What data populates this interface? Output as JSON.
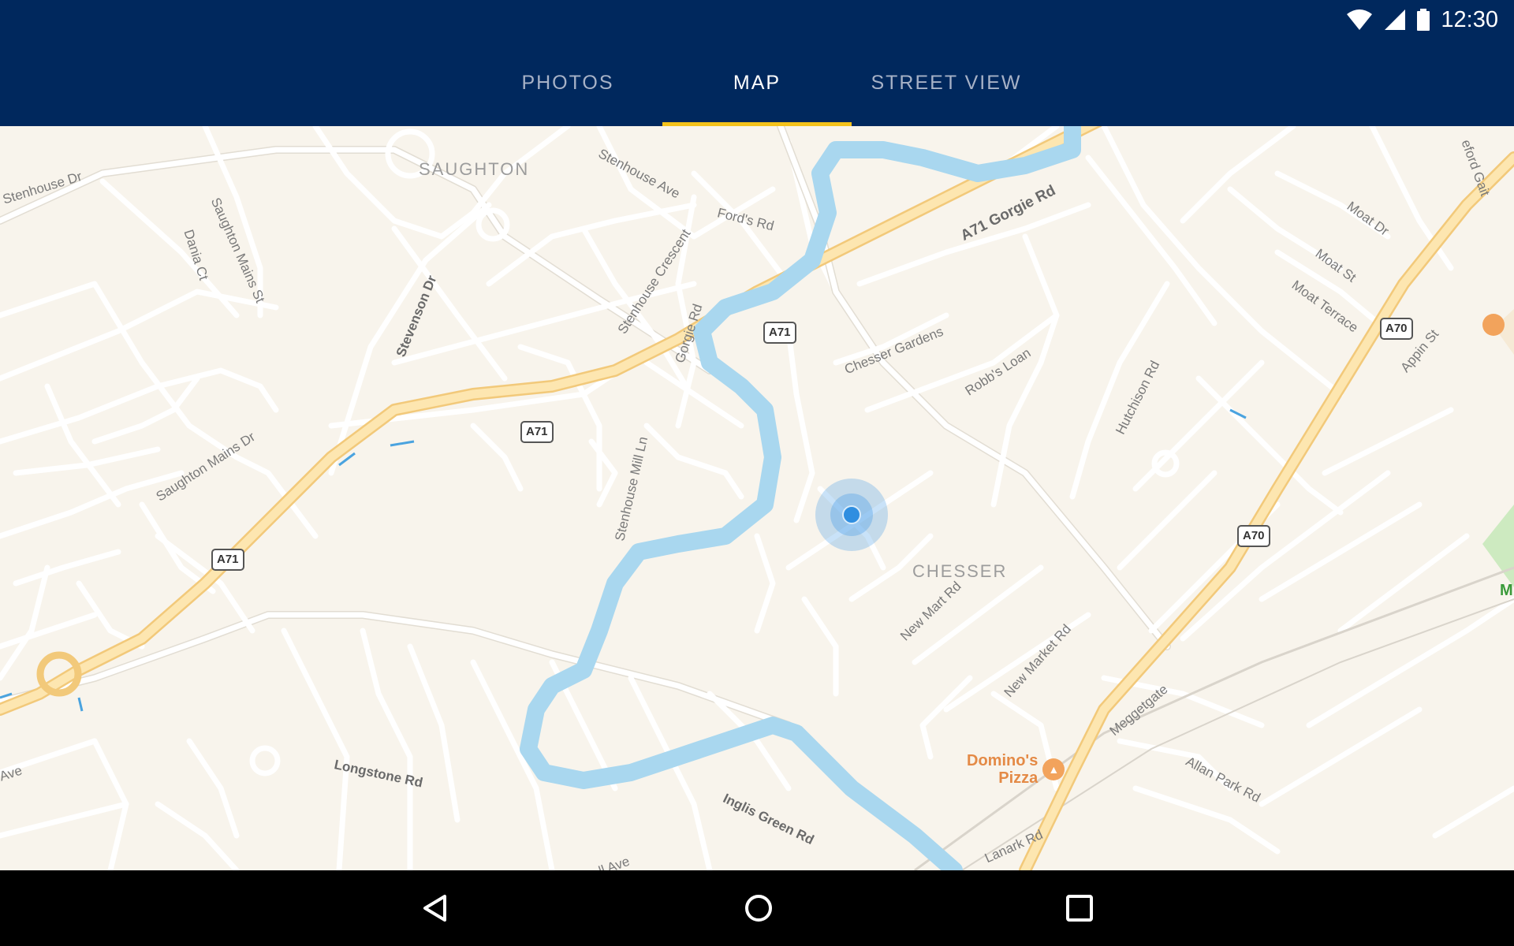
{
  "status": {
    "time": "12:30",
    "icons": [
      "wifi-icon",
      "cell-signal-icon",
      "battery-icon"
    ]
  },
  "tabs": [
    {
      "label": "PHOTOS",
      "active": false
    },
    {
      "label": "MAP",
      "active": true
    },
    {
      "label": "STREET VIEW",
      "active": false
    }
  ],
  "colors": {
    "header_bg": "#00285d",
    "tab_indicator": "#f4c21b",
    "map_bg": "#f8f4ec",
    "river": "#a9d7ef",
    "location": "#2f8ee0"
  },
  "map": {
    "areas": {
      "saughton": "SAUGHTON",
      "chesser": "CHESSER"
    },
    "streets": {
      "stenhouse_dr": "Stenhouse Dr",
      "dania_ct": "Dania Ct",
      "saughton_mains_st": "Saughton Mains St",
      "stenhouse_ave": "Stenhouse Ave",
      "fords_rd": "Ford's Rd",
      "stevenson_dr": "Stevenson Dr",
      "stenhouse_crescent": "Stenhouse Crescent",
      "gorgie_rd_small": "Gorgie Rd",
      "a71_gorgie_rd": "A71  Gorgie Rd",
      "moat_dr": "Moat Dr",
      "moat_st": "Moat St",
      "moat_terrace": "Moat Terrace",
      "appin_st": "Appin St",
      "chesser_gardens": "Chesser Gardens",
      "robbs_loan": "Robb's Loan",
      "hutchison_rd": "Hutchison Rd",
      "saughton_mains_dr": "Saughton Mains Dr",
      "stenhouse_mill_ln": "Stenhouse Mill Ln",
      "new_mart_rd": "New Mart Rd",
      "new_market_rd": "New Market Rd",
      "meggetgate": "Meggetgate",
      "allan_park_rd": "Allan Park Rd",
      "longstone_rd": "Longstone Rd",
      "inglis_green_rd": "Inglis Green Rd",
      "lanark_rd": "Lanark Rd",
      "ave_left": "Ave",
      "ave_bottom": "ll Ave",
      "gait_top": "eford Gait"
    },
    "shields": {
      "a71_top": "A71",
      "a71_mid": "A71",
      "a71_left": "A71",
      "a70_top": "A70",
      "a70_mid": "A70"
    },
    "poi": {
      "dominos": "Domino's\nPizza",
      "dominos_line1": "Domino's",
      "dominos_line2": "Pizza",
      "right_edge_letter": "M"
    }
  },
  "nav": {
    "back": "back-icon",
    "home": "home-icon",
    "recents": "recents-icon"
  }
}
